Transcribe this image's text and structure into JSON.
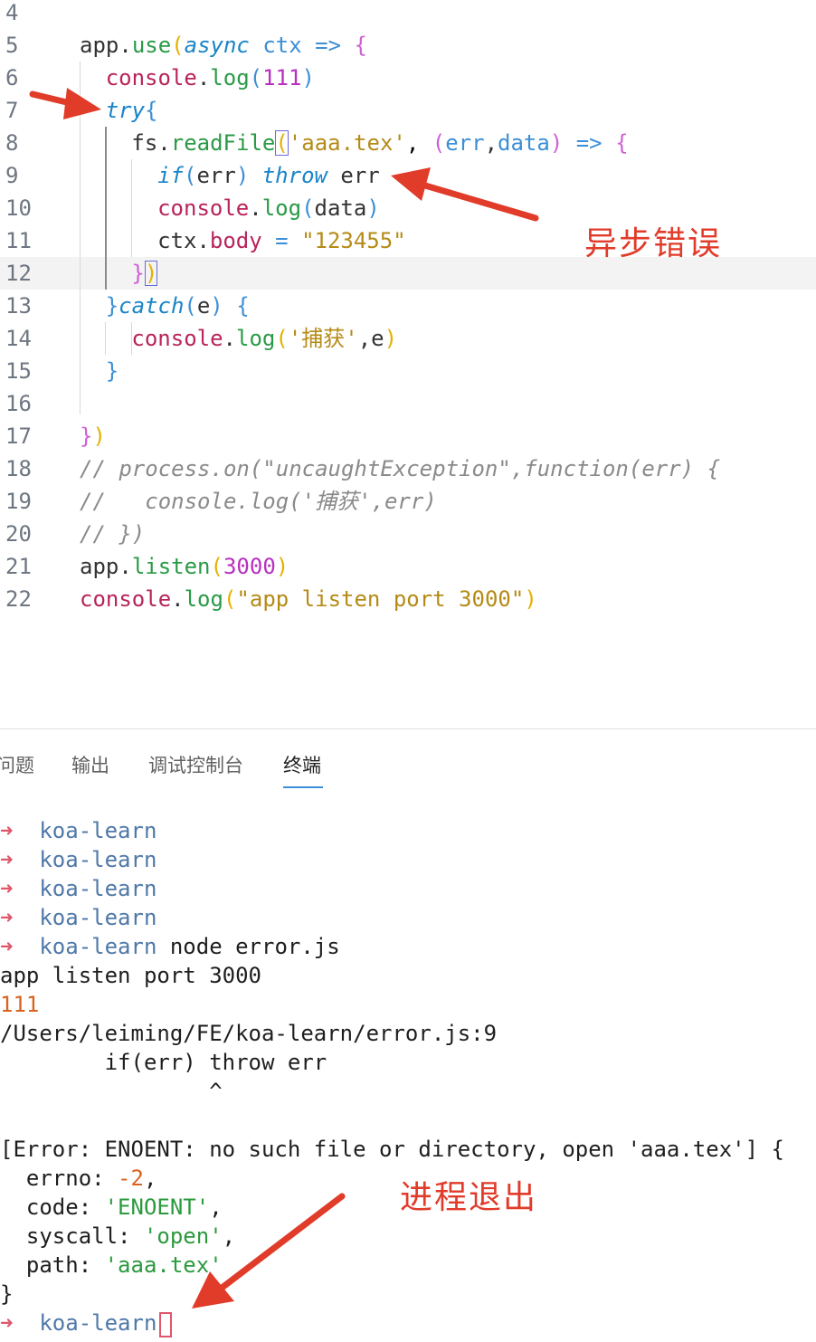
{
  "editor": {
    "lines": [
      {
        "num": "4"
      },
      {
        "num": "5",
        "tokens": [
          [
            "app",
            "v"
          ],
          [
            ".",
            "v"
          ],
          [
            "use",
            "f"
          ],
          [
            "(",
            "p1"
          ],
          [
            "async",
            "k"
          ],
          [
            " ",
            ""
          ],
          [
            "ctx",
            "op"
          ],
          [
            " ",
            ""
          ],
          [
            "=>",
            "op"
          ],
          [
            " ",
            ""
          ],
          [
            "{",
            "p2"
          ]
        ]
      },
      {
        "num": "6",
        "tokens": [
          [
            "console",
            "cs"
          ],
          [
            ".",
            "v"
          ],
          [
            "log",
            "f"
          ],
          [
            "(",
            "p3"
          ],
          [
            "111",
            "n"
          ],
          [
            ")",
            "p3"
          ]
        ]
      },
      {
        "num": "7",
        "tokens": [
          [
            "try",
            "k"
          ],
          [
            "{",
            "p3"
          ]
        ]
      },
      {
        "num": "8",
        "tokens": [
          [
            "fs",
            "v"
          ],
          [
            ".",
            "v"
          ],
          [
            "readFile",
            "f"
          ],
          [
            "(",
            "p1 bbox"
          ],
          [
            "'aaa.tex'",
            "s"
          ],
          [
            ", ",
            ""
          ],
          [
            "(",
            "p2"
          ],
          [
            "err",
            "op"
          ],
          [
            ",",
            "v"
          ],
          [
            "data",
            "op"
          ],
          [
            ")",
            "p2"
          ],
          [
            " ",
            ""
          ],
          [
            "=>",
            "op"
          ],
          [
            " ",
            ""
          ],
          [
            "{",
            "p2"
          ]
        ]
      },
      {
        "num": "9",
        "tokens": [
          [
            "if",
            "k"
          ],
          [
            "(",
            "p3"
          ],
          [
            "err",
            "v"
          ],
          [
            ")",
            "p3"
          ],
          [
            " ",
            ""
          ],
          [
            "throw",
            "k"
          ],
          [
            " err",
            "v"
          ]
        ]
      },
      {
        "num": "10",
        "tokens": [
          [
            "console",
            "cs"
          ],
          [
            ".",
            "v"
          ],
          [
            "log",
            "f"
          ],
          [
            "(",
            "p3"
          ],
          [
            "data",
            "v"
          ],
          [
            ")",
            "p3"
          ]
        ]
      },
      {
        "num": "11",
        "tokens": [
          [
            "ctx",
            "v"
          ],
          [
            ".",
            "v"
          ],
          [
            "body",
            "cs"
          ],
          [
            " ",
            ""
          ],
          [
            "=",
            "op"
          ],
          [
            " ",
            ""
          ],
          [
            "\"123455\"",
            "s"
          ]
        ]
      },
      {
        "num": "12",
        "tokens": [
          [
            "}",
            "p2"
          ],
          [
            ")",
            "p1 bbox"
          ]
        ]
      },
      {
        "num": "13",
        "tokens": [
          [
            "}",
            "p3"
          ],
          [
            "catch",
            "k"
          ],
          [
            "(",
            "p3"
          ],
          [
            "e",
            "v"
          ],
          [
            ")",
            "p3"
          ],
          [
            " ",
            ""
          ],
          [
            "{",
            "p3"
          ]
        ]
      },
      {
        "num": "14",
        "tokens": [
          [
            "console",
            "cs"
          ],
          [
            ".",
            "v"
          ],
          [
            "log",
            "f"
          ],
          [
            "(",
            "p1"
          ],
          [
            "'捕获'",
            "s"
          ],
          [
            ",",
            "v"
          ],
          [
            "e",
            "v"
          ],
          [
            ")",
            "p1"
          ]
        ]
      },
      {
        "num": "15",
        "tokens": [
          [
            "}",
            "p3"
          ]
        ]
      },
      {
        "num": "16"
      },
      {
        "num": "17",
        "tokens": [
          [
            "}",
            "p2"
          ],
          [
            ")",
            "p1"
          ]
        ]
      },
      {
        "num": "18",
        "tokens": [
          [
            "// process.on(\"uncaughtException\",function(err) {",
            "cm"
          ]
        ]
      },
      {
        "num": "19",
        "tokens": [
          [
            "//   console.log('捕获',err)",
            "cm"
          ]
        ]
      },
      {
        "num": "20",
        "tokens": [
          [
            "// })",
            "cm"
          ]
        ]
      },
      {
        "num": "21",
        "tokens": [
          [
            "app",
            "v"
          ],
          [
            ".",
            "v"
          ],
          [
            "listen",
            "f"
          ],
          [
            "(",
            "p1"
          ],
          [
            "3000",
            "n"
          ],
          [
            ")",
            "p1"
          ]
        ]
      },
      {
        "num": "22",
        "tokens": [
          [
            "console",
            "cs"
          ],
          [
            ".",
            "v"
          ],
          [
            "log",
            "f"
          ],
          [
            "(",
            "p1"
          ],
          [
            "\"app listen port 3000\"",
            "s"
          ],
          [
            ")",
            "p1"
          ]
        ]
      }
    ]
  },
  "annotations": {
    "async_error": "异步错误",
    "process_exit": "进程退出",
    "arrow_color": "#e13b2a"
  },
  "panel": {
    "tabs": [
      "问题",
      "输出",
      "调试控制台",
      "终端"
    ],
    "active_tab": "终端"
  },
  "terminal": {
    "prompt_arrow": "➜",
    "prompt_dir": "koa-learn",
    "command": "node error.js",
    "output": {
      "listen": "app listen port 3000",
      "log_value": "111",
      "error_location": "/Users/leiming/FE/koa-learn/error.js:9",
      "error_code_line": "        if(err) throw err",
      "caret_line": "                ^",
      "error_header": "[Error: ENOENT: no such file or directory, open 'aaa.tex'] {",
      "errno_key": "  errno: ",
      "errno_val": "-2",
      "code_key": "  code: ",
      "code_val": "'ENOENT'",
      "syscall_key": "  syscall: ",
      "syscall_val": "'open'",
      "path_key": "  path: ",
      "path_val": "'aaa.tex'",
      "close_brace": "}"
    }
  }
}
